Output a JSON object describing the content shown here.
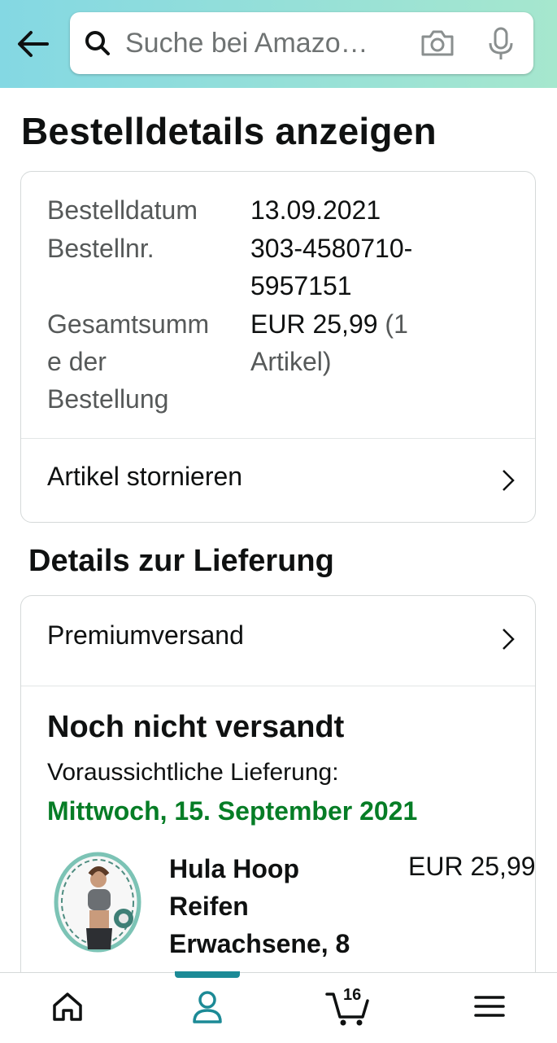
{
  "header": {
    "search_placeholder": "Suche bei Amazo…",
    "back_icon": "arrow-left-icon",
    "search_icon": "search-icon",
    "camera_icon": "camera-icon",
    "mic_icon": "microphone-icon"
  },
  "page_title": "Bestelldetails anzeigen",
  "order": {
    "date_label": "Bestelldatum",
    "date_value": "13.09.2021",
    "number_label": "Bestellnr.",
    "number_value_line1": "303-4580710-",
    "number_value_line2": "5957151",
    "total_label_line1": "Gesamtsumm",
    "total_label_line2": "e der",
    "total_label_line3": "Bestellung",
    "total_value_amount": "EUR 25,99",
    "total_value_items_line1": "(1",
    "total_value_items_line2": "Artikel)",
    "cancel_label": "Artikel stornieren"
  },
  "delivery": {
    "section_title": "Details zur Lieferung",
    "shipping_method": "Premiumversand",
    "status": "Noch nicht versandt",
    "eta_label": "Voraussichtliche Lieferung:",
    "eta_date": "Mittwoch, 15. September 2021",
    "product": {
      "title_line1": "Hula Hoop",
      "title_line2": "Reifen",
      "title_line3": "Erwachsene, 8",
      "price": "EUR 25,99"
    }
  },
  "bottom_nav": {
    "items": [
      "home-icon",
      "account-icon",
      "cart-icon",
      "menu-icon"
    ],
    "active": "account-icon",
    "cart_count": "16"
  },
  "colors": {
    "header_gradient_start": "#84d8e3",
    "header_gradient_end": "#a6e7ce",
    "delivery_green": "#067d26",
    "active_nav": "#1c8a96"
  }
}
